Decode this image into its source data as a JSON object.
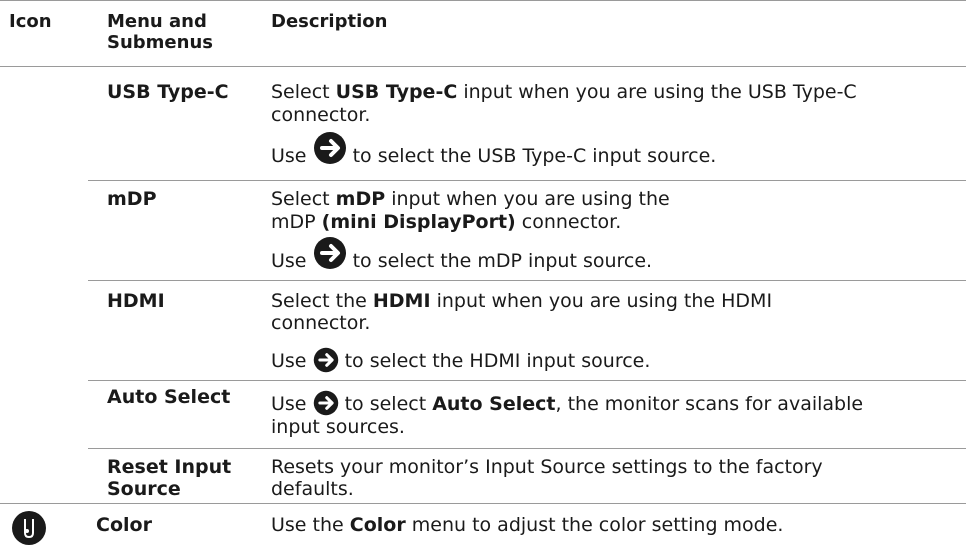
{
  "header": {
    "col_icon": "Icon",
    "col_menu_line1": "Menu and",
    "col_menu_line2": "Submenus",
    "col_desc": "Description"
  },
  "rows": {
    "usbc": {
      "menu": "USB Type-C",
      "d1a": "Select ",
      "d1b": "USB Type-C",
      "d1c": " input when you are using the USB Type-C",
      "d2": "connector.",
      "u1": "Use ",
      "u2": " to select the USB Type-C input source."
    },
    "mdp": {
      "menu": "mDP",
      "d1a": "Select ",
      "d1b": "mDP",
      "d1c": " input when you are using the",
      "d2a": "mDP ",
      "d2b": "(mini DisplayPort)",
      "d2c": " connector.",
      "u1": "Use ",
      "u2": " to select the mDP input source."
    },
    "hdmi": {
      "menu": "HDMI",
      "d1a": "Select the ",
      "d1b": "HDMI",
      "d1c": " input when you are using the HDMI",
      "d2": "connector.",
      "u1": "Use ",
      "u2": " to select the HDMI input source."
    },
    "auto": {
      "menu": "Auto Select",
      "u1": "Use ",
      "u2": " to select ",
      "u3": "Auto Select",
      "u4": ", the monitor scans for available",
      "d2": "input sources."
    },
    "reset": {
      "menu1": "Reset Input",
      "menu2": "Source",
      "d1": "Resets your monitor’s Input Source settings to the factory",
      "d2": "defaults."
    },
    "color": {
      "menu": "Color",
      "d1a": "Use the ",
      "d1b": "Color",
      "d1c": " menu to adjust the color setting mode.",
      "icon": "color-palette-icon"
    }
  }
}
